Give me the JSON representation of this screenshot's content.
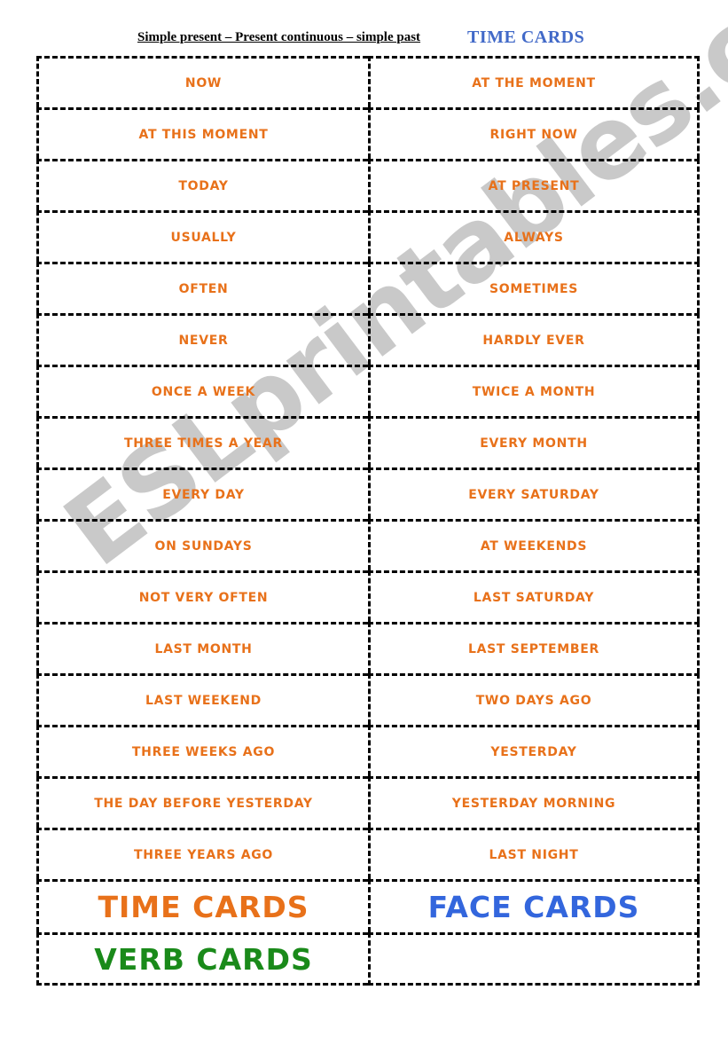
{
  "header": {
    "title_left": "Simple present – Present continuous – simple past",
    "title_right": "TIME CARDS"
  },
  "watermark": {
    "text": "ESLprintables.com"
  },
  "colors": {
    "card_text_orange": "#e8711a",
    "heading_green": "#1a8a1a",
    "heading_blue": "#3366dd",
    "header_blue": "#4169c8",
    "cut_line_black": "#000000",
    "watermark_gray": "#c9c9c9"
  },
  "cards": {
    "rows": [
      {
        "left": "NOW",
        "right": "AT THE MOMENT"
      },
      {
        "left": "AT THIS MOMENT",
        "right": "RIGHT NOW"
      },
      {
        "left": "TODAY",
        "right": "AT PRESENT"
      },
      {
        "left": "USUALLY",
        "right": "ALWAYS"
      },
      {
        "left": "OFTEN",
        "right": "SOMETIMES"
      },
      {
        "left": "NEVER",
        "right": "HARDLY EVER"
      },
      {
        "left": "ONCE A WEEK",
        "right": "TWICE A MONTH"
      },
      {
        "left": "THREE TIMES A YEAR",
        "right": "EVERY MONTH"
      },
      {
        "left": "EVERY DAY",
        "right": "EVERY SATURDAY"
      },
      {
        "left": "ON SUNDAYS",
        "right": "AT WEEKENDS"
      },
      {
        "left": "NOT VERY OFTEN",
        "right": "LAST SATURDAY"
      },
      {
        "left": "LAST MONTH",
        "right": "LAST SEPTEMBER"
      },
      {
        "left": "LAST WEEKEND",
        "right": "TWO DAYS  AGO"
      },
      {
        "left": "THREE WEEKS AGO",
        "right": "YESTERDAY"
      },
      {
        "left": "THE DAY BEFORE YESTERDAY",
        "right": "YESTERDAY MORNING"
      },
      {
        "left": "THREE YEARS AGO",
        "right": "LAST NIGHT"
      }
    ],
    "heading_rows": [
      {
        "left": "TIME CARDS",
        "left_color": "orange",
        "right": "FACE CARDS",
        "right_color": "blue"
      },
      {
        "left": "VERB CARDS",
        "left_color": "green",
        "right": "",
        "right_color": "orange"
      }
    ]
  }
}
